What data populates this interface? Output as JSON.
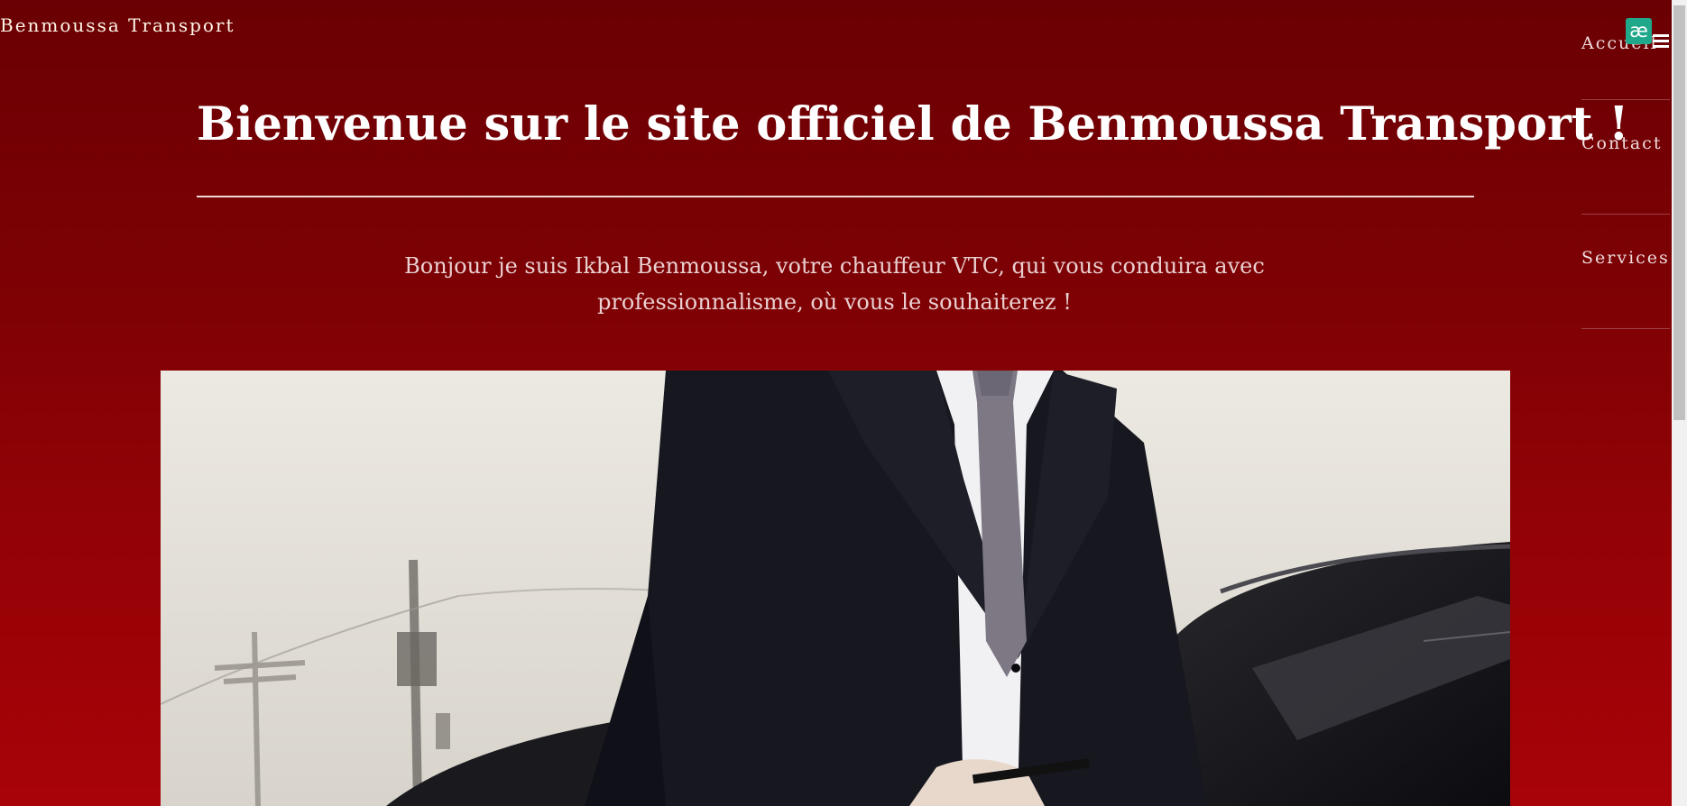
{
  "header": {
    "brand": "Benmoussa Transport"
  },
  "nav": {
    "items": [
      {
        "label": "Accueil"
      },
      {
        "label": "Contact"
      },
      {
        "label": "Services"
      }
    ]
  },
  "main": {
    "title": "Bienvenue sur le site officiel de Benmoussa Transport !",
    "intro": "Bonjour je suis Ikbal Benmoussa, votre chauffeur VTC, qui vous conduira avec professionnalisme, où vous le souhaiterez !"
  },
  "icons": {
    "extension": "ae-extension-icon",
    "menu": "hamburger-menu-icon"
  },
  "colors": {
    "background_top": "#6a0003",
    "background_bottom": "#a80308",
    "extension_icon": "#1fa88a"
  }
}
